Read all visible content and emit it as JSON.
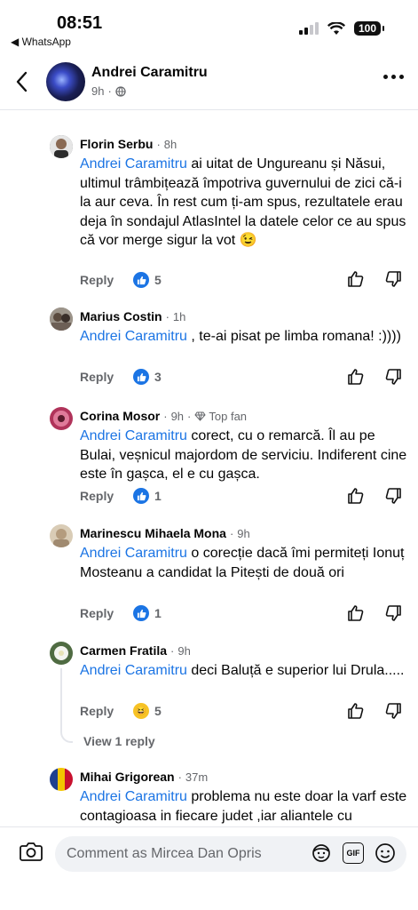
{
  "status_bar": {
    "time": "08:51",
    "back_app": "◀ WhatsApp",
    "battery": "100"
  },
  "header": {
    "name": "Andrei Caramitru",
    "time": "9h",
    "privacy_icon": "globe-icon"
  },
  "comments": [
    {
      "name": "Florin Serbu",
      "time": "8h",
      "badge": "",
      "mention": "Andrei Caramitru",
      "text": " ai uitat de Ungureanu și Năsui, ultimul trâmbițează împotriva guvernului de zici că-i la aur ceva. În rest cum ți-am spus, rezultatele erau deja în sondajul AtlasIntel la datele celor ce au spus că vor merge sigur la vot 😉",
      "reply_label": "Reply",
      "reaction": "like",
      "count": "5",
      "avatar_color": "#6b6f75"
    },
    {
      "name": "Marius Costin",
      "time": "1h",
      "badge": "",
      "mention": "Andrei Caramitru",
      "text": " , te-ai pisat pe limba romana! :))))",
      "reply_label": "Reply",
      "reaction": "like",
      "count": "3",
      "avatar_color": "#8a8377"
    },
    {
      "name": "Corina Mosor",
      "time": "9h",
      "badge": "Top fan",
      "mention": "Andrei Caramitru",
      "text": " corect, cu o remarcă. Îl au pe Bulai, veșnicul majordom de serviciu. Indiferent cine este în gașca, el e cu gașca.",
      "reply_label": "Reply",
      "reaction": "like",
      "count": "1",
      "avatar_color": "#b0335a"
    },
    {
      "name": "Marinescu Mihaela Mona",
      "time": "9h",
      "badge": "",
      "mention": "Andrei Caramitru",
      "text": "  o corecție   dacă îmi  permiteți Ionuț  Mosteanu a candidat  la Pitești    de două ori",
      "reply_label": "Reply",
      "reaction": "like",
      "count": "1",
      "avatar_color": "#c8b79c"
    },
    {
      "name": "Carmen Fratila",
      "time": "9h",
      "badge": "",
      "mention": "Andrei Caramitru",
      "text": " deci Baluță e superior lui Drula.....",
      "reply_label": "Reply",
      "reaction": "haha",
      "count": "5",
      "avatar_color": "#5d7f4c"
    },
    {
      "name": "Mihai Grigorean",
      "time": "37m",
      "badge": "",
      "mention": "Andrei Caramitru",
      "text": " problema nu este doar la varf este contagioasa in fiecare judet ,iar aliantele cu",
      "reply_label": "",
      "reaction": "",
      "count": "",
      "avatar_color": "#1f3f8f"
    }
  ],
  "view_replies": "View 1 reply",
  "composer": {
    "placeholder": "Comment as Mircea Dan Opris",
    "gif_label": "GIF"
  },
  "colors": {
    "accent": "#1b74e4",
    "muted": "#65676b"
  }
}
